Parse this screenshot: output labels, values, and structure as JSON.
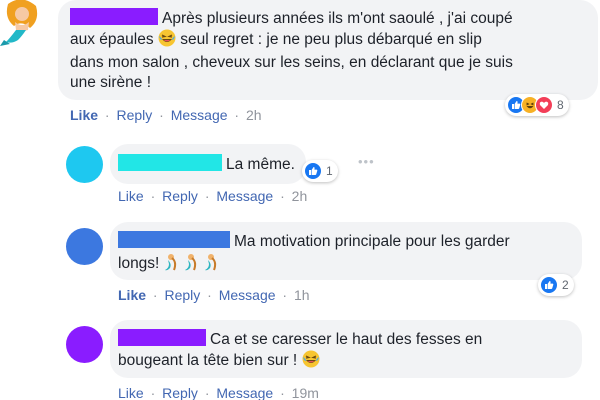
{
  "actions": {
    "like": "Like",
    "reply": "Reply",
    "message": "Message",
    "sep": "·"
  },
  "comments": [
    {
      "text_lines": [
        "Après plusieurs années ils m'ont saoulé , j'ai coupé",
        "aux épaules",
        "seul regret : je ne peu plus débarqué en slip",
        "dans mon salon , cheveux sur les seins, en déclarant que je suis",
        "une sirène !"
      ],
      "time": "2h",
      "reactions": {
        "count": "8",
        "types": [
          "like",
          "haha",
          "love"
        ]
      },
      "avatar": "mermaid-avatar",
      "redact_color": "#8a1cff"
    },
    {
      "text_lines": [
        "La même."
      ],
      "time": "2h",
      "reactions": {
        "count": "1",
        "types": [
          "like"
        ]
      },
      "avatar_color": "#1ec8f0",
      "redact_color": "#22e6e6"
    },
    {
      "text_lines": [
        "Ma motivation principale pour les garder",
        "longs!"
      ],
      "time": "1h",
      "reactions": {
        "count": "2",
        "types": [
          "like"
        ]
      },
      "avatar_color": "#3c78e0",
      "redact_color": "#3c78e0"
    },
    {
      "text_lines": [
        "Ca et se caresser le haut des fesses en",
        "bougeant la tête bien sur !"
      ],
      "time": "19m",
      "avatar_color": "#8a1cff",
      "redact_color": "#8a1cff"
    }
  ],
  "colors": {
    "link": "#4267b2",
    "meta": "#90949c",
    "bubble": "#f2f3f5"
  },
  "icons": [
    "laughing-emoji-icon",
    "mermaid-icon",
    "like-reaction-icon",
    "haha-reaction-icon",
    "love-reaction-icon",
    "more-options-icon"
  ]
}
